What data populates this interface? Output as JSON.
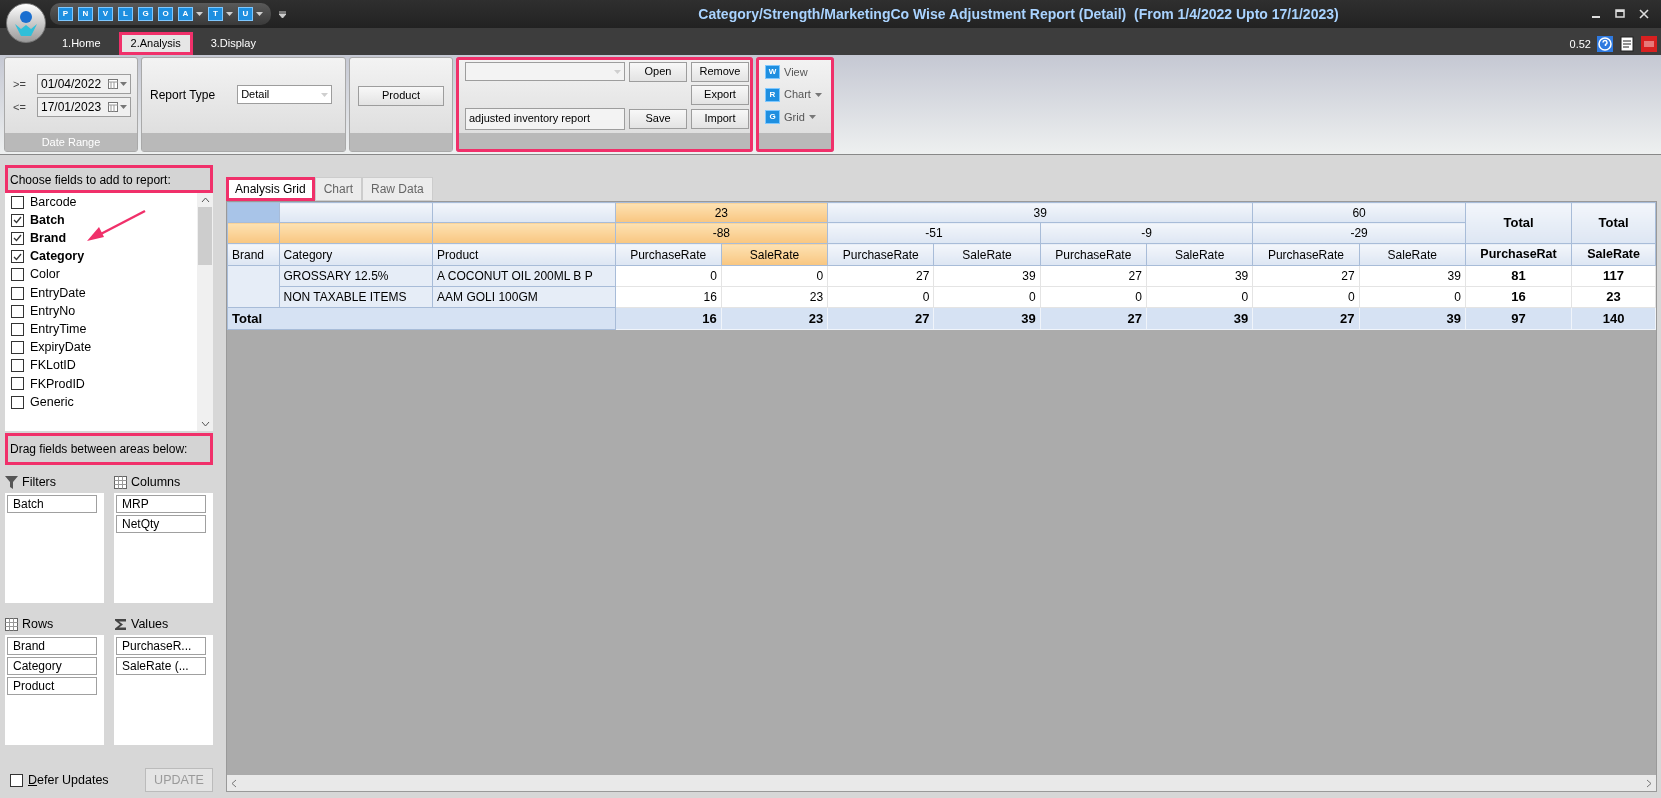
{
  "title_bar": {
    "title": "Category/Strength/MarketingCo Wise Adjustment Report (Detail)  (From 1/4/2022 Upto 17/1/2023)",
    "quick_access": [
      {
        "letter": "P",
        "dropdown": false
      },
      {
        "letter": "N",
        "dropdown": false
      },
      {
        "letter": "V",
        "dropdown": false
      },
      {
        "letter": "L",
        "dropdown": false
      },
      {
        "letter": "G",
        "dropdown": false
      },
      {
        "letter": "O",
        "dropdown": false
      },
      {
        "letter": "A",
        "dropdown": true
      },
      {
        "letter": "T",
        "dropdown": true
      },
      {
        "letter": "U",
        "dropdown": true
      }
    ]
  },
  "ribbon_tabs": [
    {
      "label": "1.Home",
      "selected": false,
      "highlighted": false
    },
    {
      "label": "2.Analysis",
      "selected": true,
      "highlighted": true
    },
    {
      "label": "3.Display",
      "selected": false,
      "highlighted": false
    }
  ],
  "version": "0.52",
  "date_range": {
    "caption": "Date Range",
    "from_label": ">=",
    "from": "01/04/2022",
    "to_label": "<=",
    "to": "17/01/2023"
  },
  "report_type": {
    "label": "Report Type",
    "value": "Detail"
  },
  "product_button": "Product",
  "layout_group": {
    "highlighted": true,
    "layout_name": "adjusted inventory report",
    "open": "Open",
    "remove": "Remove",
    "export": "Export",
    "save": "Save",
    "import": "Import"
  },
  "view_group": {
    "highlighted": true,
    "items": [
      {
        "letter": "W",
        "label": "View",
        "dropdown": false
      },
      {
        "letter": "R",
        "label": "Chart",
        "dropdown": true
      },
      {
        "letter": "G",
        "label": "Grid",
        "dropdown": true
      }
    ]
  },
  "field_list": {
    "header": "Choose fields to add to report:",
    "highlighted": true,
    "fields": [
      {
        "label": "Barcode",
        "checked": false
      },
      {
        "label": "Batch",
        "checked": true
      },
      {
        "label": "Brand",
        "checked": true
      },
      {
        "label": "Category",
        "checked": true
      },
      {
        "label": "Color",
        "checked": false
      },
      {
        "label": "EntryDate",
        "checked": false
      },
      {
        "label": "EntryNo",
        "checked": false
      },
      {
        "label": "EntryTime",
        "checked": false
      },
      {
        "label": "ExpiryDate",
        "checked": false
      },
      {
        "label": "FKLotID",
        "checked": false
      },
      {
        "label": "FKProdID",
        "checked": false
      },
      {
        "label": "Generic",
        "checked": false
      }
    ]
  },
  "areas": {
    "header": "Drag fields between areas below:",
    "highlighted": true,
    "panes": [
      {
        "kind": "filters",
        "label": "Filters",
        "items": [
          "Batch"
        ]
      },
      {
        "kind": "columns",
        "label": "Columns",
        "items": [
          "MRP",
          "NetQty"
        ]
      },
      {
        "kind": "rows",
        "label": "Rows",
        "items": [
          "Brand",
          "Category",
          "Product"
        ]
      },
      {
        "kind": "values",
        "label": "Values",
        "items": [
          "PurchaseR...",
          "SaleRate (..."
        ]
      }
    ]
  },
  "defer_updates": {
    "label": "Defer Updates",
    "checked": false
  },
  "update_button": {
    "label": "UPDATE",
    "disabled": true
  },
  "view_tabs": [
    {
      "label": "Analysis Grid",
      "selected": true,
      "highlighted": true
    },
    {
      "label": "Chart",
      "selected": false,
      "highlighted": false
    },
    {
      "label": "Raw Data",
      "selected": false,
      "highlighted": false
    }
  ],
  "pivot": {
    "row_fields": [
      "Brand",
      "Category",
      "Product"
    ],
    "column_groups": [
      {
        "label": "23",
        "selected": true,
        "subgroups": [
          {
            "label": "-88",
            "selected": true,
            "measures": [
              {
                "label": "PurchaseRate",
                "selected": false
              },
              {
                "label": "SaleRate",
                "selected": true
              }
            ]
          }
        ]
      },
      {
        "label": "39",
        "selected": false,
        "subgroups": [
          {
            "label": "-51",
            "selected": false,
            "measures": [
              {
                "label": "PurchaseRate",
                "selected": false
              },
              {
                "label": "SaleRate",
                "selected": false
              }
            ]
          },
          {
            "label": "-9",
            "selected": false,
            "measures": [
              {
                "label": "PurchaseRate",
                "selected": false
              },
              {
                "label": "SaleRate",
                "selected": false
              }
            ]
          }
        ]
      },
      {
        "label": "60",
        "selected": false,
        "subgroups": [
          {
            "label": "-29",
            "selected": false,
            "measures": [
              {
                "label": "PurchaseRate",
                "selected": false
              },
              {
                "label": "SaleRate",
                "selected": false
              }
            ]
          }
        ]
      }
    ],
    "grand_totals": [
      {
        "label": "Total",
        "measure": "PurchaseRat"
      },
      {
        "label": "Total",
        "measure": "SaleRate"
      }
    ],
    "rows": [
      {
        "category": "GROSSARY 12.5%",
        "product": "A COCONUT OIL 200ML B P",
        "values": [
          "0",
          "0",
          "27",
          "39",
          "27",
          "39",
          "27",
          "39"
        ],
        "totals": [
          "81",
          "117"
        ]
      },
      {
        "category": "NON TAXABLE ITEMS",
        "product": "AAM GOLI 100GM",
        "values": [
          "16",
          "23",
          "0",
          "0",
          "0",
          "0",
          "0",
          "0"
        ],
        "totals": [
          "16",
          "23"
        ]
      }
    ],
    "total_row": {
      "label": "Total",
      "values": [
        "16",
        "23",
        "27",
        "39",
        "27",
        "39",
        "27",
        "39"
      ],
      "totals": [
        "97",
        "140"
      ]
    }
  }
}
